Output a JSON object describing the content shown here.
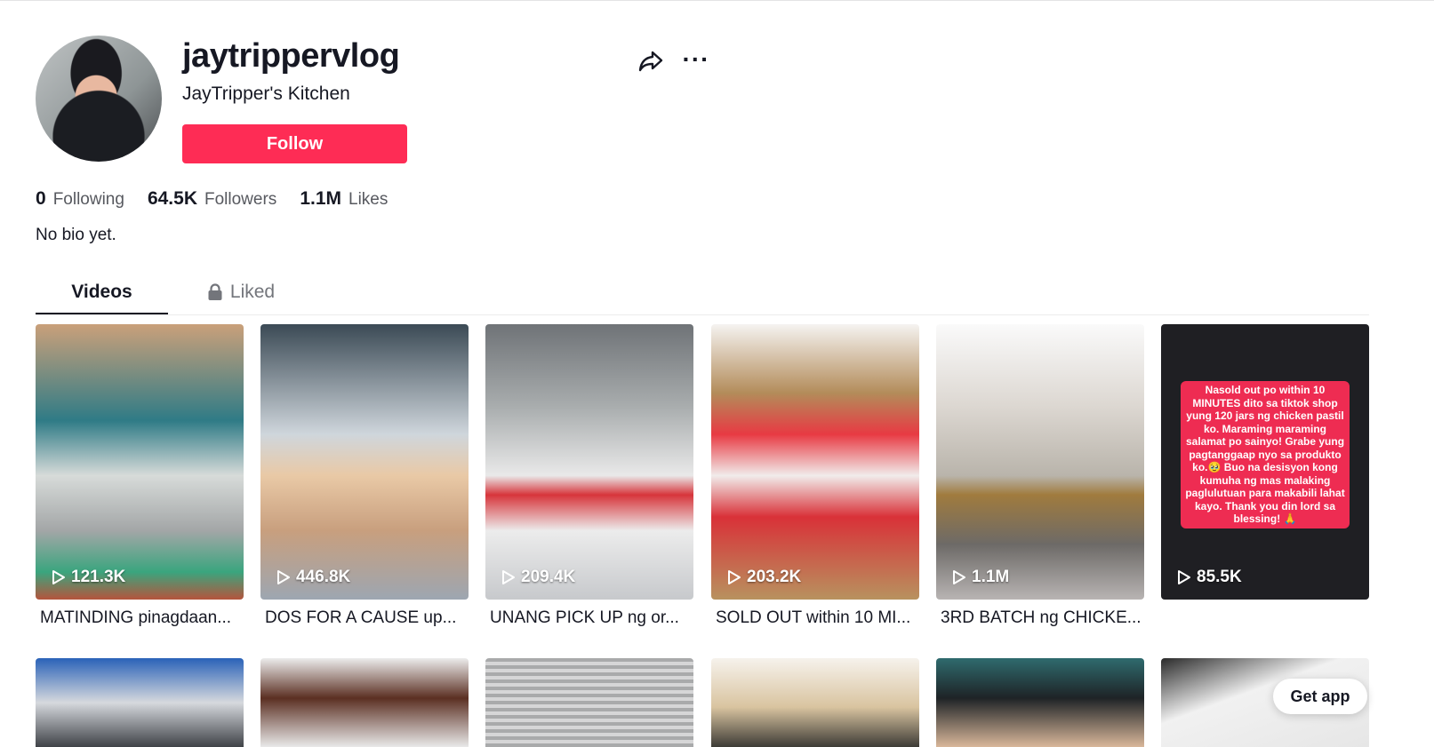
{
  "profile": {
    "username": "jaytrippervlog",
    "nickname": "JayTripper's Kitchen",
    "follow_label": "Follow",
    "more_label": "···",
    "bio": "No bio yet."
  },
  "stats": [
    {
      "value": "0",
      "label": "Following"
    },
    {
      "value": "64.5K",
      "label": "Followers"
    },
    {
      "value": "1.1M",
      "label": "Likes"
    }
  ],
  "tabs": [
    {
      "label": "Videos",
      "active": true
    },
    {
      "label": "Liked",
      "locked": true
    }
  ],
  "videos": [
    {
      "views": "121.3K",
      "caption": "MATINDING pinagdaan..."
    },
    {
      "views": "446.8K",
      "caption": "DOS FOR A CAUSE up..."
    },
    {
      "views": "209.4K",
      "caption": "UNANG PICK UP ng or..."
    },
    {
      "views": "203.2K",
      "caption": "SOLD OUT within 10 MI..."
    },
    {
      "views": "1.1M",
      "caption": "3RD BATCH ng CHICKE..."
    },
    {
      "views": "85.5K",
      "caption": "",
      "overlay_text": "Nasold out po within 10 MINUTES dito sa tiktok shop yung 120 jars ng chicken pastil ko. Maraming maraming salamat po sainyo! Grabe yung pagtanggaap nyo sa produkto ko.🥹 Buo na desisyon kong kumuha ng mas malaking paglulutuan para makabili lahat kayo. Thank you din lord sa blessing! 🙏"
    }
  ],
  "get_app_label": "Get app",
  "colors": {
    "accent": "#fe2c55",
    "text": "#161823",
    "muted": "#57595f"
  }
}
